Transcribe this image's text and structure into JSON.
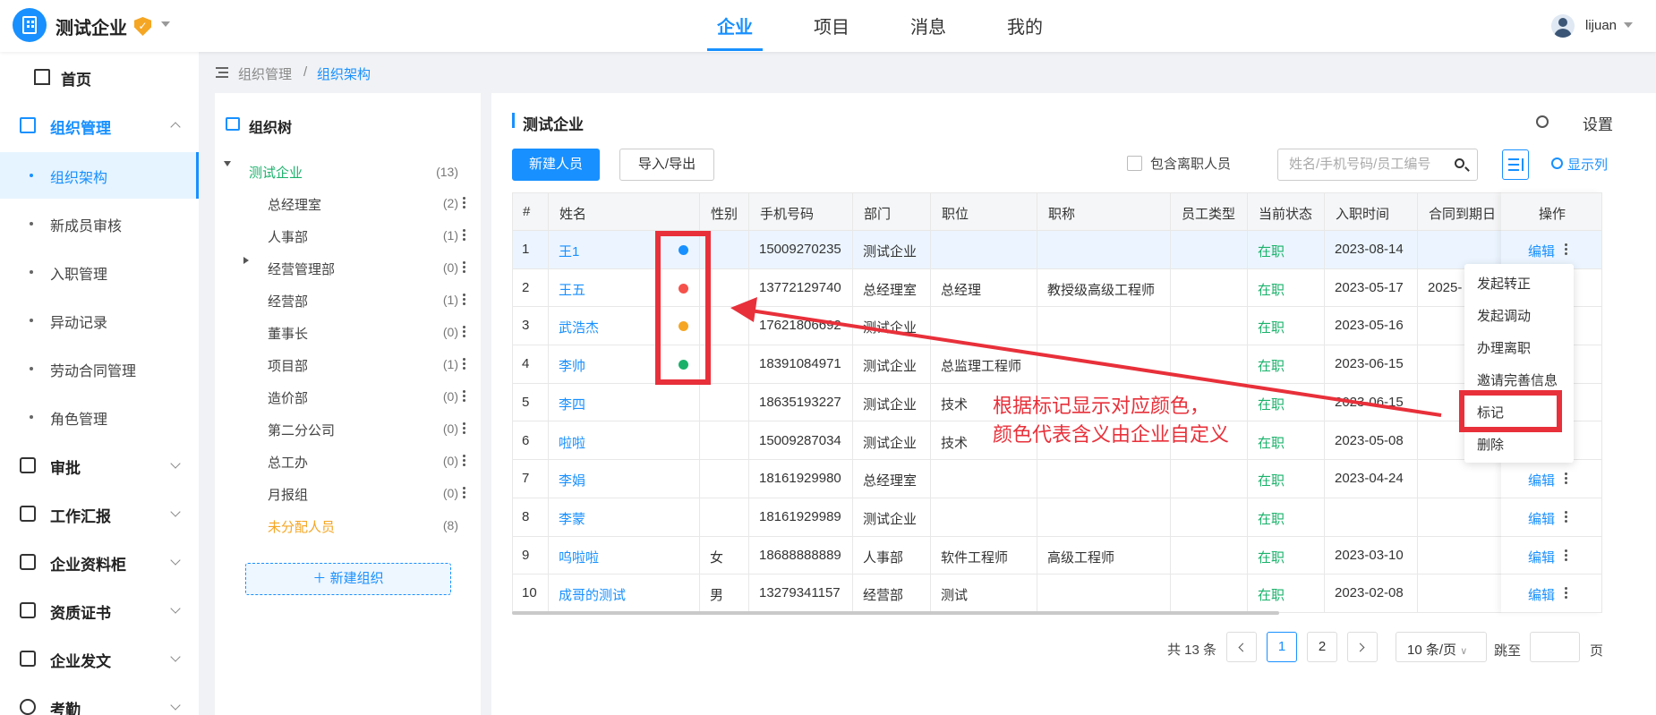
{
  "header": {
    "company": "测试企业",
    "nav_tabs": [
      "企业",
      "项目",
      "消息",
      "我的"
    ],
    "username": "lijuan"
  },
  "sidebar": {
    "items": [
      {
        "label": "首页"
      },
      {
        "label": "组织管理"
      },
      {
        "label": "组织架构"
      },
      {
        "label": "新成员审核"
      },
      {
        "label": "入职管理"
      },
      {
        "label": "异动记录"
      },
      {
        "label": "劳动合同管理"
      },
      {
        "label": "角色管理"
      },
      {
        "label": "审批"
      },
      {
        "label": "工作汇报"
      },
      {
        "label": "企业资料柜"
      },
      {
        "label": "资质证书"
      },
      {
        "label": "企业发文"
      },
      {
        "label": "考勤"
      }
    ]
  },
  "breadcrumb": {
    "parent": "组织管理",
    "sep": "/",
    "current": "组织架构"
  },
  "tree": {
    "title": "组织树",
    "root": {
      "name": "测试企业",
      "count": "(13)"
    },
    "nodes": [
      {
        "name": "总经理室",
        "count": "(2)"
      },
      {
        "name": "人事部",
        "count": "(1)"
      },
      {
        "name": "经营管理部",
        "count": "(0)"
      },
      {
        "name": "经营部",
        "count": "(1)"
      },
      {
        "name": "董事长",
        "count": "(0)"
      },
      {
        "name": "项目部",
        "count": "(1)"
      },
      {
        "name": "造价部",
        "count": "(0)"
      },
      {
        "name": "第二分公司",
        "count": "(0)"
      },
      {
        "name": "总工办",
        "count": "(0)"
      },
      {
        "name": "月报组",
        "count": "(0)"
      },
      {
        "name": "未分配人员",
        "count": "(8)"
      }
    ],
    "new_org_label": "新建组织"
  },
  "main": {
    "title": "测试企业",
    "settings_label": "设置",
    "new_person_label": "新建人员",
    "import_export_label": "导入/导出",
    "include_left_label": "包含离职人员",
    "search_placeholder": "姓名/手机号码/员工编号",
    "show_columns_label": "显示列"
  },
  "table": {
    "headers": [
      "#",
      "姓名",
      "性别",
      "手机号码",
      "部门",
      "职位",
      "职称",
      "员工类型",
      "当前状态",
      "入职时间",
      "合同到期日",
      "操作"
    ],
    "edit_label": "编辑",
    "rows": [
      {
        "no": "1",
        "name": "王1",
        "gender": "",
        "phone": "15009270235",
        "dept": "测试企业",
        "position": "",
        "title": "",
        "type": "",
        "status": "在职",
        "join": "2023-08-14",
        "contract": "",
        "mark": "#1890ff"
      },
      {
        "no": "2",
        "name": "王五",
        "gender": "",
        "phone": "13772129740",
        "dept": "总经理室",
        "position": "总经理",
        "title": "教授级高级工程师",
        "type": "",
        "status": "在职",
        "join": "2023-05-17",
        "contract": "2025-",
        "mark": "#f5524b"
      },
      {
        "no": "3",
        "name": "武浩杰",
        "gender": "",
        "phone": "17621806692",
        "dept": "测试企业",
        "position": "",
        "title": "",
        "type": "",
        "status": "在职",
        "join": "2023-05-16",
        "contract": "",
        "mark": "#f5a623"
      },
      {
        "no": "4",
        "name": "李帅",
        "gender": "",
        "phone": "18391084971",
        "dept": "测试企业",
        "position": "总监理工程师",
        "title": "",
        "type": "",
        "status": "在职",
        "join": "2023-06-15",
        "contract": "",
        "mark": "#1ab26b"
      },
      {
        "no": "5",
        "name": "李四",
        "gender": "",
        "phone": "18635193227",
        "dept": "测试企业",
        "position": "技术",
        "title": "",
        "type": "",
        "status": "在职",
        "join": "2023-06-15",
        "contract": "",
        "mark": ""
      },
      {
        "no": "6",
        "name": "啦啦",
        "gender": "",
        "phone": "15009287034",
        "dept": "测试企业",
        "position": "技术",
        "title": "",
        "type": "",
        "status": "在职",
        "join": "2023-05-08",
        "contract": "",
        "mark": ""
      },
      {
        "no": "7",
        "name": "李娟",
        "gender": "",
        "phone": "18161929980",
        "dept": "总经理室",
        "position": "",
        "title": "",
        "type": "",
        "status": "在职",
        "join": "2023-04-24",
        "contract": "",
        "mark": ""
      },
      {
        "no": "8",
        "name": "李蒙",
        "gender": "",
        "phone": "18161929989",
        "dept": "测试企业",
        "position": "",
        "title": "",
        "type": "",
        "status": "在职",
        "join": "",
        "contract": "",
        "mark": ""
      },
      {
        "no": "9",
        "name": "呜啦啦",
        "gender": "女",
        "phone": "18688888889",
        "dept": "人事部",
        "position": "软件工程师",
        "title": "高级工程师",
        "type": "",
        "status": "在职",
        "join": "2023-03-10",
        "contract": "",
        "mark": ""
      },
      {
        "no": "10",
        "name": "成哥的测试",
        "gender": "男",
        "phone": "13279341157",
        "dept": "经营部",
        "position": "测试",
        "title": "",
        "type": "",
        "status": "在职",
        "join": "2023-02-08",
        "contract": "",
        "mark": ""
      }
    ]
  },
  "dropdown": {
    "items": [
      "发起转正",
      "发起调动",
      "办理离职",
      "邀请完善信息",
      "标记",
      "删除"
    ]
  },
  "pagination": {
    "total": "共 13 条",
    "pages": [
      "1",
      "2"
    ],
    "page_size": "10 条/页",
    "jump_label": "跳至",
    "page_label": "页"
  },
  "annotation": {
    "line1": "根据标记显示对应颜色，",
    "line2": "颜色代表含义由企业自定义",
    "color": "#e8303a"
  }
}
